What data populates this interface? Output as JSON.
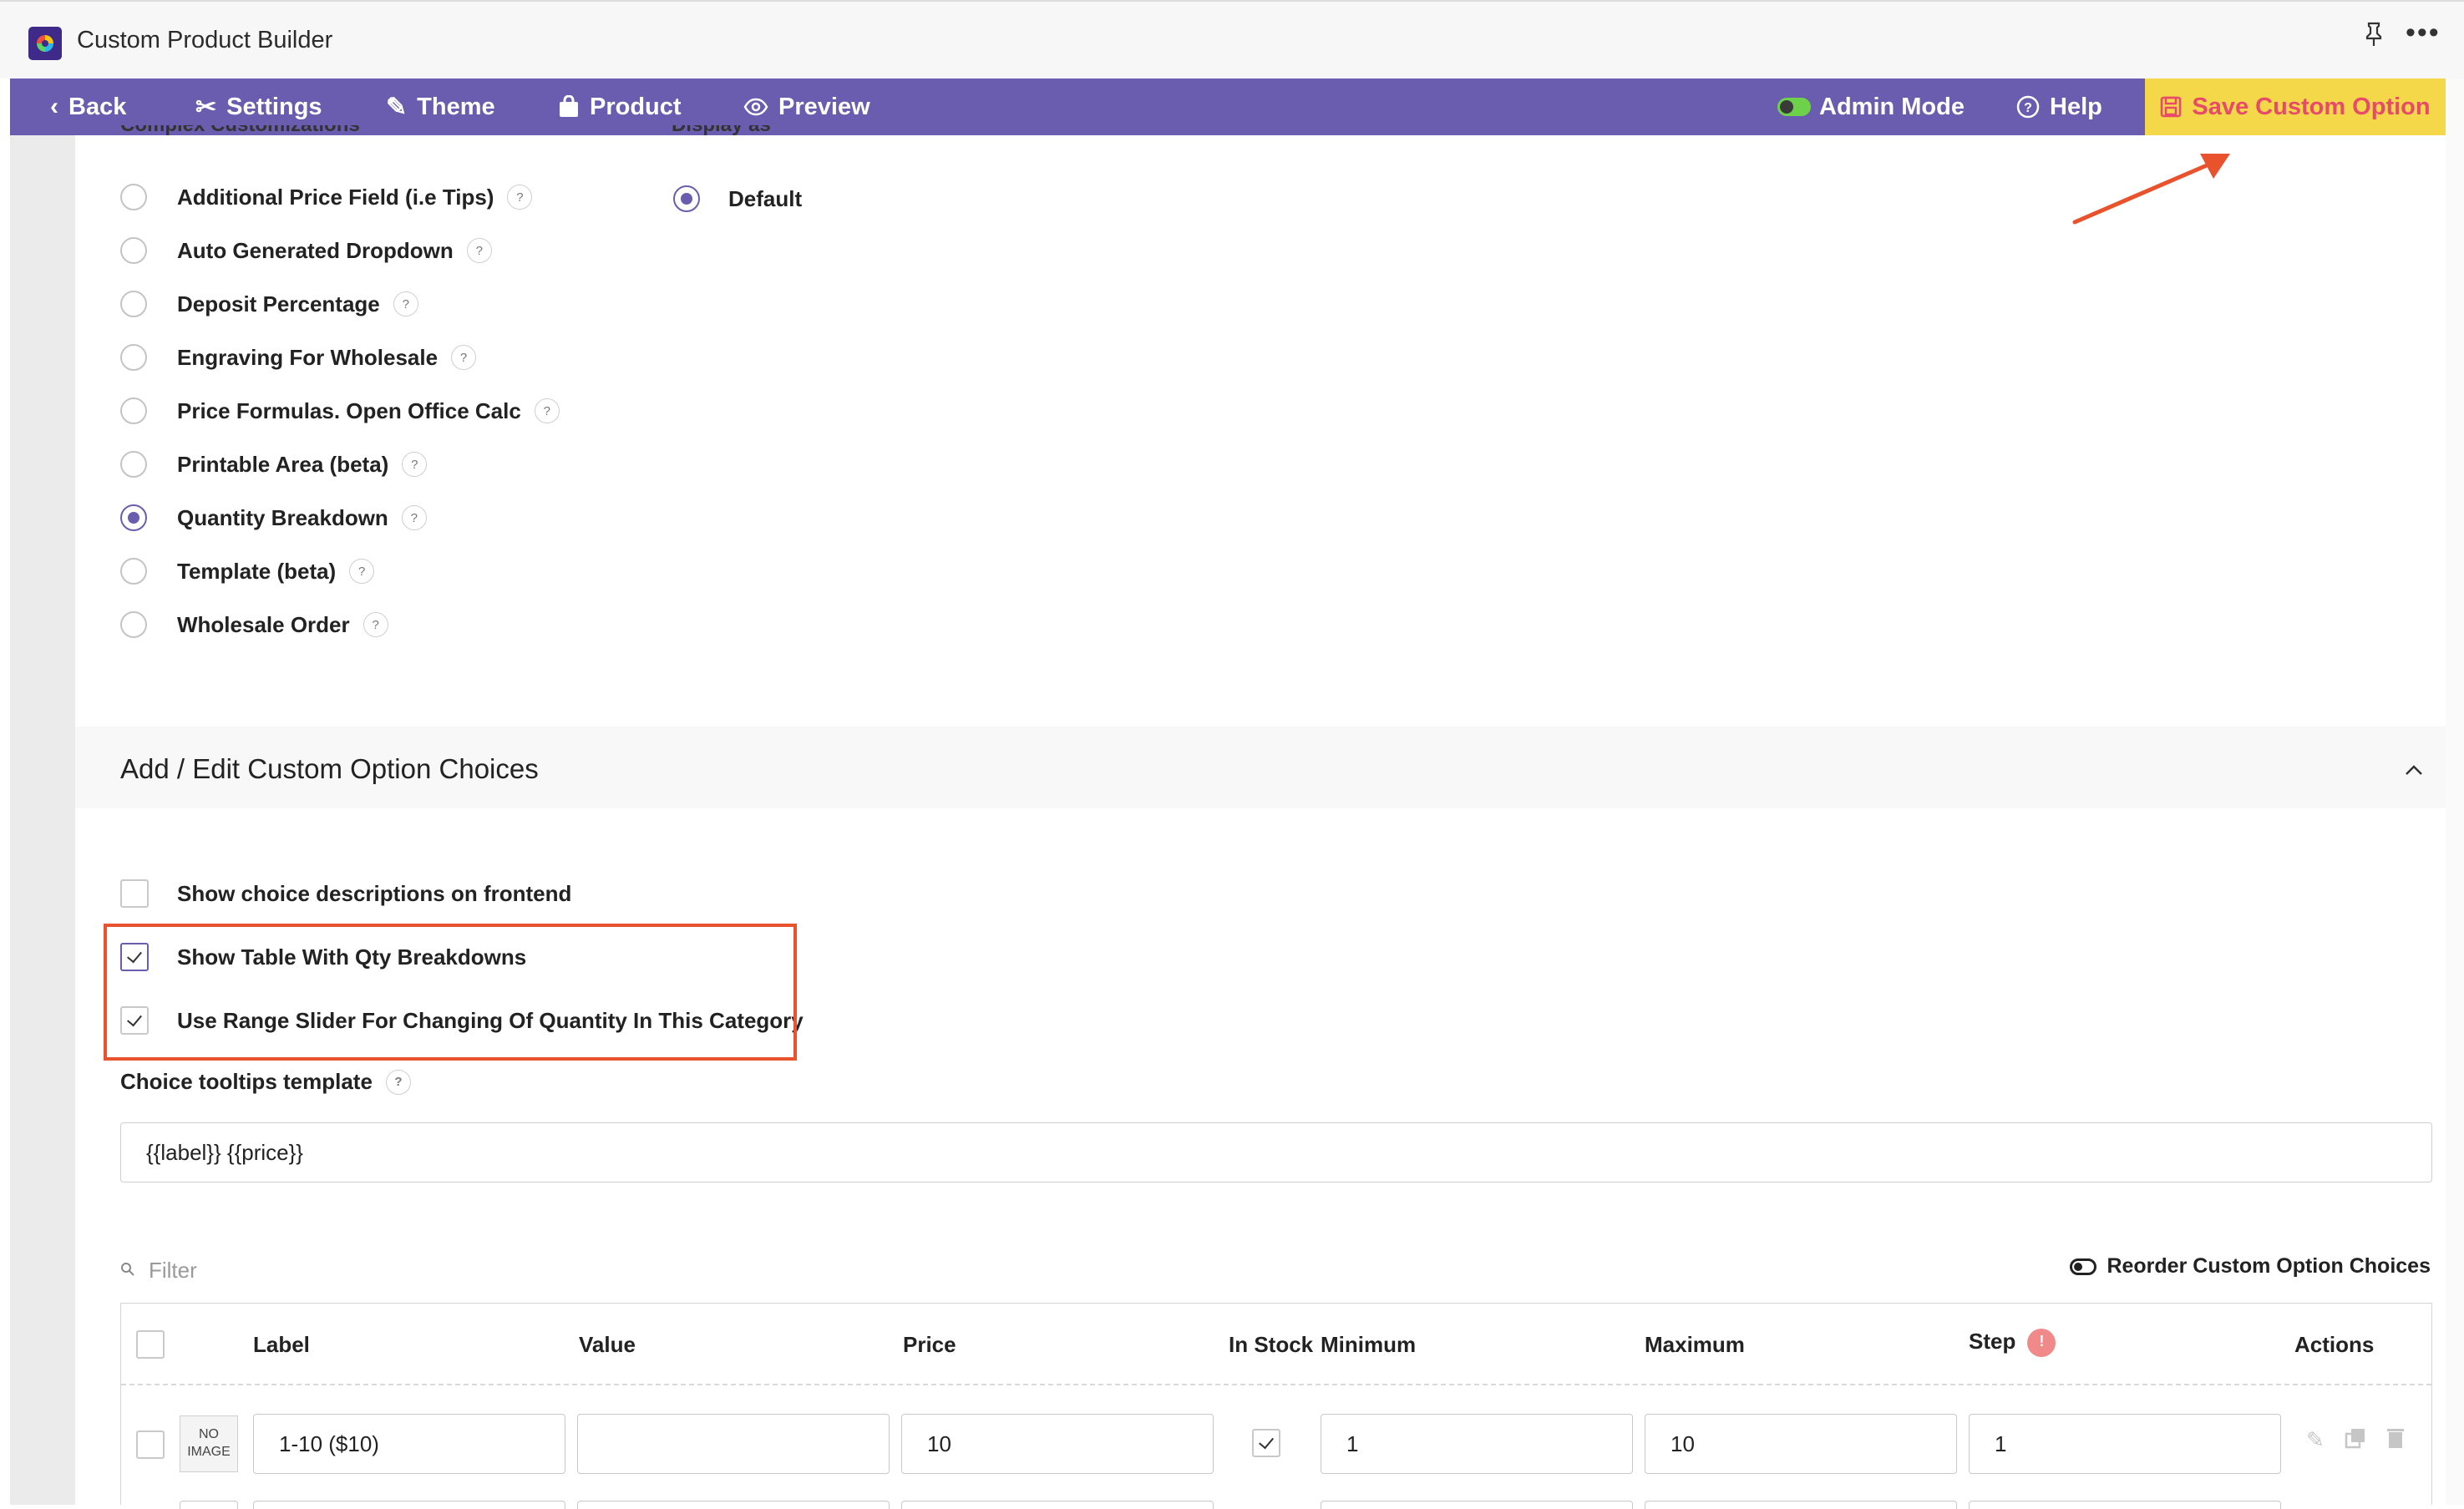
{
  "window": {
    "title": "Custom Product Builder"
  },
  "nav": {
    "back": "Back",
    "settings": "Settings",
    "theme": "Theme",
    "product": "Product",
    "preview": "Preview",
    "admin_mode": "Admin Mode",
    "help": "Help",
    "save": "Save Custom Option"
  },
  "complex": {
    "label": "Complex Customizations",
    "options": [
      {
        "label": "Additional Price Field (i.e Tips)",
        "selected": false
      },
      {
        "label": "Auto Generated Dropdown",
        "selected": false
      },
      {
        "label": "Deposit Percentage",
        "selected": false
      },
      {
        "label": "Engraving For Wholesale",
        "selected": false
      },
      {
        "label": "Price Formulas. Open Office Calc",
        "selected": false
      },
      {
        "label": "Printable Area (beta)",
        "selected": false
      },
      {
        "label": "Quantity Breakdown",
        "selected": true
      },
      {
        "label": "Template (beta)",
        "selected": false
      },
      {
        "label": "Wholesale Order",
        "selected": false
      }
    ],
    "help_glyph": "?"
  },
  "display_as": {
    "label": "Display as",
    "options": [
      {
        "label": "Default",
        "selected": true
      }
    ]
  },
  "choices_section": {
    "title": "Add / Edit Custom Option Choices",
    "checkboxes": [
      {
        "label": "Show choice descriptions on frontend",
        "checked": false
      },
      {
        "label": "Show Table With Qty Breakdowns",
        "checked": true
      },
      {
        "label": "Use Range Slider For Changing Of Quantity In This Category",
        "checked": true
      }
    ],
    "tooltip_template": {
      "label": "Choice tooltips template",
      "value": "{{label}} {{price}}"
    },
    "filter_placeholder": "Filter",
    "reorder": "Reorder Custom Option Choices"
  },
  "table": {
    "headers": [
      "Label",
      "Value",
      "Price",
      "In Stock",
      "Minimum",
      "Maximum",
      "Step",
      "Actions"
    ],
    "rows": [
      {
        "image": "NO IMAGE",
        "label": "1-10 ($10)",
        "value": "",
        "price": "10",
        "in_stock": true,
        "minimum": "1",
        "maximum": "10",
        "step": "1"
      }
    ]
  },
  "colors": {
    "nav_bg": "#6a5caf",
    "save_bg": "#f4d84a",
    "save_text": "#e84a6a",
    "annotation": "#e8532e"
  }
}
